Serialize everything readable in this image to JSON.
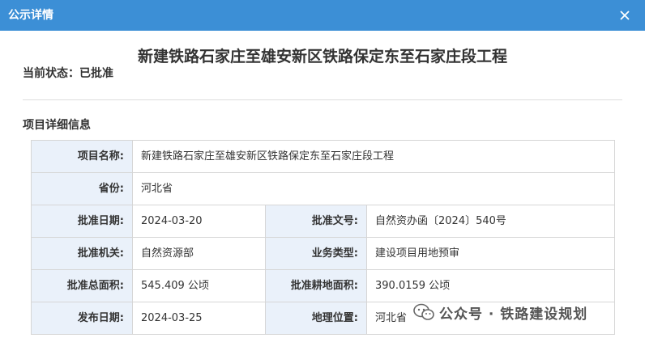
{
  "window": {
    "title": "公示详情",
    "accent_color": "#3c8fd6"
  },
  "page": {
    "title": "新建铁路石家庄至雄安新区铁路保定东至石家庄段工程",
    "status_text": "当前状态：已批准",
    "section_title": "项目详细信息"
  },
  "details": {
    "row1": {
      "label": "项目名称:",
      "value": "新建铁路石家庄至雄安新区铁路保定东至石家庄段工程"
    },
    "row2": {
      "label": "省份:",
      "value": "河北省"
    },
    "row3": {
      "left": {
        "label": "批准日期:",
        "value": "2024-03-20"
      },
      "right": {
        "label": "批准文号:",
        "value": "自然资办函〔2024〕540号"
      }
    },
    "row4": {
      "left": {
        "label": "批准机关:",
        "value": "自然资源部"
      },
      "right": {
        "label": "业务类型:",
        "value": "建设项目用地预审"
      }
    },
    "row5": {
      "left": {
        "label": "批准总面积:",
        "value": "545.409 公顷"
      },
      "right": {
        "label": "批准耕地面积:",
        "value": "390.0159 公顷"
      }
    },
    "row6": {
      "left": {
        "label": "发布日期:",
        "value": "2024-03-25"
      },
      "right": {
        "label": "地理位置:",
        "value": "河北省"
      }
    }
  },
  "watermark": {
    "text": "公众号 · 铁路建设规划",
    "icon": "wechat-icon"
  }
}
